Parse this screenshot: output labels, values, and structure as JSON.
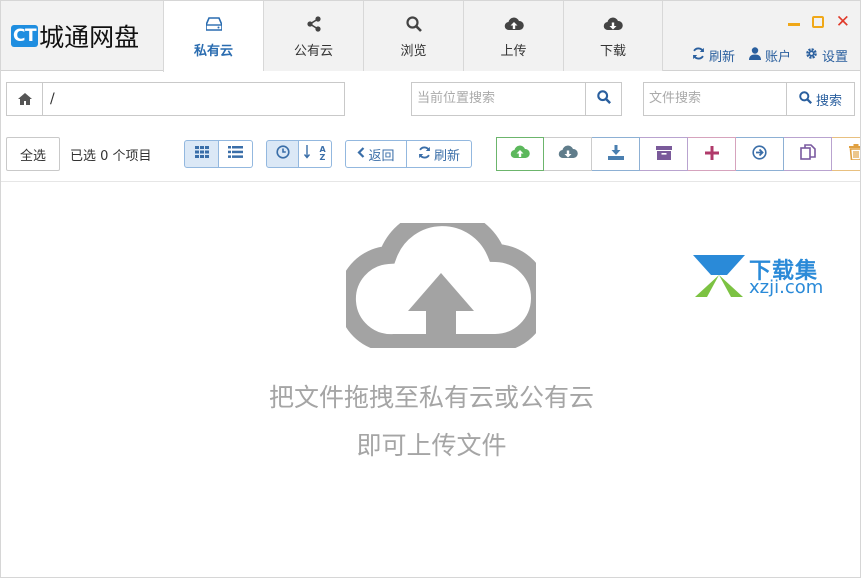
{
  "logo": {
    "badge": "CT",
    "name": "城通网盘"
  },
  "tabs": [
    {
      "label": "私有云",
      "icon": "drive-icon",
      "active": true
    },
    {
      "label": "公有云",
      "icon": "share-icon",
      "active": false
    },
    {
      "label": "浏览",
      "icon": "search-icon",
      "active": false
    },
    {
      "label": "上传",
      "icon": "cloud-upload-icon",
      "active": false
    },
    {
      "label": "下载",
      "icon": "cloud-download-icon",
      "active": false
    }
  ],
  "header_links": {
    "refresh": "刷新",
    "account": "账户",
    "settings": "设置"
  },
  "path": {
    "value": "/"
  },
  "search_local": {
    "placeholder": "当前位置搜索"
  },
  "search_files": {
    "placeholder": "文件搜索",
    "button": "搜索"
  },
  "toolbar": {
    "select_all": "全选",
    "selected_count": "已选 0 个项目",
    "back": "返回",
    "refresh": "刷新",
    "sort_az": "A Z"
  },
  "actions": [
    {
      "name": "upload-icon",
      "color": "#5cb85c"
    },
    {
      "name": "cloud-download-icon",
      "color": "#607d8b"
    },
    {
      "name": "download-icon",
      "color": "#4a7fb0"
    },
    {
      "name": "archive-icon",
      "color": "#7a5a9a"
    },
    {
      "name": "plus-icon",
      "color": "#b03a6a"
    },
    {
      "name": "move-icon",
      "color": "#3a6ea8"
    },
    {
      "name": "copy-icon",
      "color": "#7a5aa0"
    },
    {
      "name": "trash-icon",
      "color": "#e0a040"
    }
  ],
  "empty_state": {
    "line1": "把文件拖拽至私有云或公有云",
    "line2": "即可上传文件"
  },
  "watermark": {
    "title": "下载集",
    "sub": "xzji.com"
  },
  "colors": {
    "accent": "#2a6cb0",
    "close": "#e03a2a",
    "window_btn": "#f0a818"
  }
}
